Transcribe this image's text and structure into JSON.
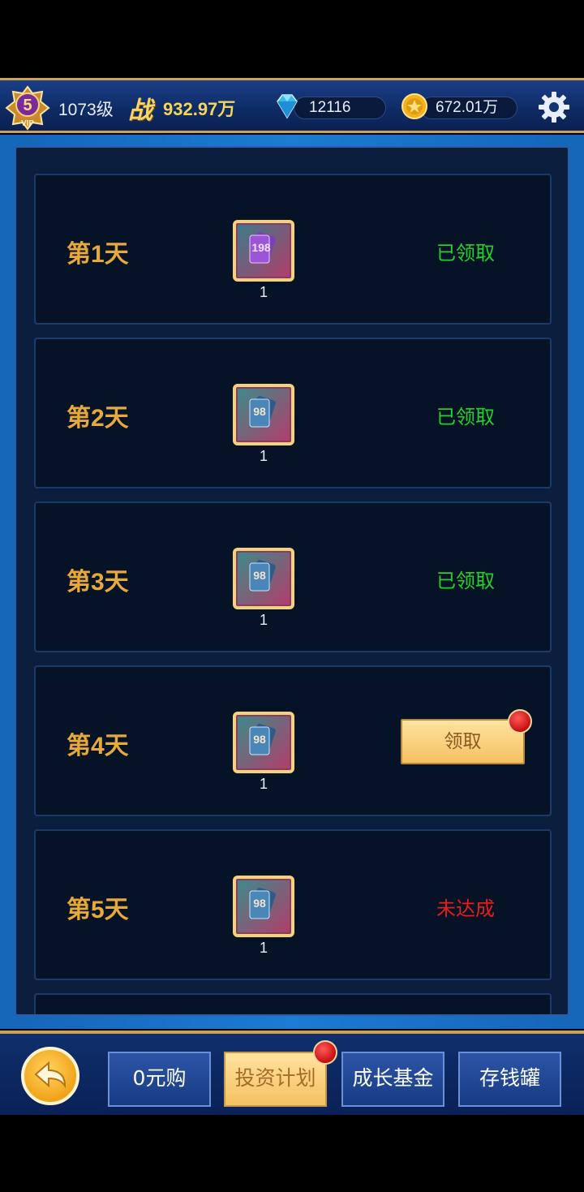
{
  "header": {
    "vip_level": "5",
    "vip_label": "VIP",
    "level": "1073级",
    "power_label": "战",
    "power": "932.97万",
    "diamonds": "12116",
    "gold": "672.01万"
  },
  "rewards": [
    {
      "day": "第1天",
      "item_value": "198",
      "quantity": "1",
      "status": "已领取",
      "state": "claimed"
    },
    {
      "day": "第2天",
      "item_value": "98",
      "quantity": "1",
      "status": "已领取",
      "state": "claimed"
    },
    {
      "day": "第3天",
      "item_value": "98",
      "quantity": "1",
      "status": "已领取",
      "state": "claimed"
    },
    {
      "day": "第4天",
      "item_value": "98",
      "quantity": "1",
      "status": "领取",
      "state": "claimable"
    },
    {
      "day": "第5天",
      "item_value": "98",
      "quantity": "1",
      "status": "未达成",
      "state": "locked"
    }
  ],
  "bottom_nav": {
    "tabs": [
      {
        "label": "0元购",
        "active": false
      },
      {
        "label": "投资计划",
        "active": true
      },
      {
        "label": "成长基金",
        "active": false
      },
      {
        "label": "存钱罐",
        "active": false
      }
    ]
  },
  "colors": {
    "day_text": "#e6a93a",
    "claimed": "#22d12b",
    "not_reached": "#e81c1c",
    "gold_button": "#f4c063"
  },
  "icons": [
    "vip-badge-icon",
    "diamond-icon",
    "gold-coin-icon",
    "settings-gear-icon",
    "card-item-icon",
    "back-arrow-icon",
    "red-dot-icon"
  ]
}
